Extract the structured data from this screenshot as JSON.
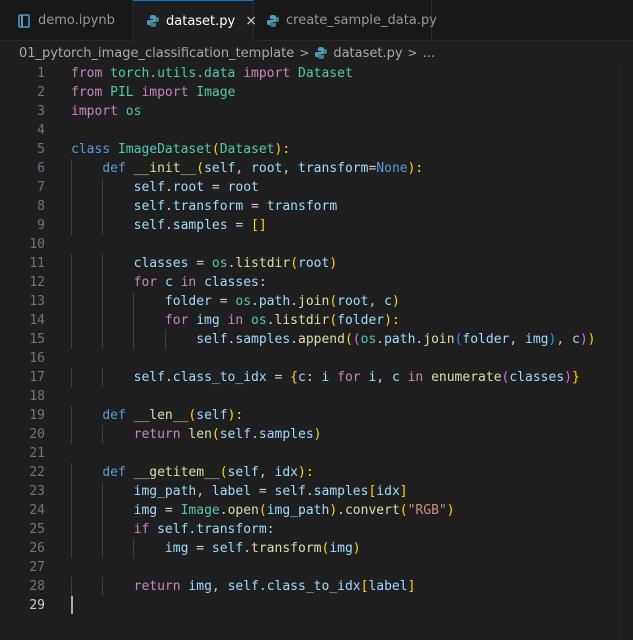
{
  "tabs": [
    {
      "label": "demo.ipynb",
      "icon": "notebook-icon",
      "active": false
    },
    {
      "label": "dataset.py",
      "icon": "python-icon",
      "active": true,
      "close": "×"
    },
    {
      "label": "create_sample_data.py",
      "icon": "python-icon",
      "active": false
    }
  ],
  "breadcrumb": {
    "folder": "01_pytorch_image_classification_template",
    "sep": ">",
    "file": "dataset.py",
    "more": "..."
  },
  "editor": {
    "current_line": 29,
    "lines": [
      [
        [
          "from ",
          "k"
        ],
        [
          "torch.utils.data",
          "c"
        ],
        [
          " ",
          ""
        ],
        [
          "import",
          "k"
        ],
        [
          " Dataset",
          "c"
        ]
      ],
      [
        [
          "from ",
          "k"
        ],
        [
          "PIL",
          "c"
        ],
        [
          " ",
          ""
        ],
        [
          "import",
          "k"
        ],
        [
          " Image",
          "c"
        ]
      ],
      [
        [
          "import",
          "k"
        ],
        [
          " os",
          "c"
        ]
      ],
      [],
      [
        [
          "class ",
          "b"
        ],
        [
          "ImageDataset",
          "c"
        ],
        [
          "(",
          "p1"
        ],
        [
          "Dataset",
          "c"
        ],
        [
          "):",
          "p1"
        ]
      ],
      [
        [
          "    ",
          ""
        ],
        [
          "def ",
          "b"
        ],
        [
          "__init__",
          "f"
        ],
        [
          "(",
          "p1"
        ],
        [
          "self",
          "v"
        ],
        [
          ", ",
          ""
        ],
        [
          "root",
          "v"
        ],
        [
          ", ",
          ""
        ],
        [
          "transform",
          "v"
        ],
        [
          "=",
          ""
        ],
        [
          "None",
          "b"
        ],
        [
          "):",
          "p1"
        ]
      ],
      [
        [
          "        ",
          ""
        ],
        [
          "self",
          "v"
        ],
        [
          ".",
          ""
        ],
        [
          "root",
          "v"
        ],
        [
          " = ",
          ""
        ],
        [
          "root",
          "v"
        ]
      ],
      [
        [
          "        ",
          ""
        ],
        [
          "self",
          "v"
        ],
        [
          ".",
          ""
        ],
        [
          "transform",
          "v"
        ],
        [
          " = ",
          ""
        ],
        [
          "transform",
          "v"
        ]
      ],
      [
        [
          "        ",
          ""
        ],
        [
          "self",
          "v"
        ],
        [
          ".",
          ""
        ],
        [
          "samples",
          "v"
        ],
        [
          " = ",
          ""
        ],
        [
          "[]",
          "p1"
        ]
      ],
      [],
      [
        [
          "        ",
          ""
        ],
        [
          "classes",
          "v"
        ],
        [
          " = ",
          ""
        ],
        [
          "os",
          "c"
        ],
        [
          ".",
          ""
        ],
        [
          "listdir",
          "f"
        ],
        [
          "(",
          "p1"
        ],
        [
          "root",
          "v"
        ],
        [
          ")",
          "p1"
        ]
      ],
      [
        [
          "        ",
          ""
        ],
        [
          "for ",
          "k"
        ],
        [
          "c",
          "v"
        ],
        [
          " in ",
          "k"
        ],
        [
          "classes",
          "v"
        ],
        [
          ":",
          ""
        ]
      ],
      [
        [
          "            ",
          ""
        ],
        [
          "folder",
          "v"
        ],
        [
          " = ",
          ""
        ],
        [
          "os",
          "c"
        ],
        [
          ".",
          ""
        ],
        [
          "path",
          "v"
        ],
        [
          ".",
          ""
        ],
        [
          "join",
          "f"
        ],
        [
          "(",
          "p1"
        ],
        [
          "root",
          "v"
        ],
        [
          ", ",
          ""
        ],
        [
          "c",
          "v"
        ],
        [
          ")",
          "p1"
        ]
      ],
      [
        [
          "            ",
          ""
        ],
        [
          "for ",
          "k"
        ],
        [
          "img",
          "v"
        ],
        [
          " in ",
          "k"
        ],
        [
          "os",
          "c"
        ],
        [
          ".",
          ""
        ],
        [
          "listdir",
          "f"
        ],
        [
          "(",
          "p1"
        ],
        [
          "folder",
          "v"
        ],
        [
          "):",
          "p1"
        ]
      ],
      [
        [
          "                ",
          ""
        ],
        [
          "self",
          "v"
        ],
        [
          ".",
          ""
        ],
        [
          "samples",
          "v"
        ],
        [
          ".",
          ""
        ],
        [
          "append",
          "f"
        ],
        [
          "(",
          "p1"
        ],
        [
          "(",
          "p2"
        ],
        [
          "os",
          "c"
        ],
        [
          ".",
          ""
        ],
        [
          "path",
          "v"
        ],
        [
          ".",
          ""
        ],
        [
          "join",
          "f"
        ],
        [
          "(",
          "p3"
        ],
        [
          "folder",
          "v"
        ],
        [
          ", ",
          ""
        ],
        [
          "img",
          "v"
        ],
        [
          ")",
          "p3"
        ],
        [
          ", ",
          ""
        ],
        [
          "c",
          "v"
        ],
        [
          ")",
          "p2"
        ],
        [
          ")",
          "p1"
        ]
      ],
      [],
      [
        [
          "        ",
          ""
        ],
        [
          "self",
          "v"
        ],
        [
          ".",
          ""
        ],
        [
          "class_to_idx",
          "v"
        ],
        [
          " = ",
          ""
        ],
        [
          "{",
          "p1"
        ],
        [
          "c",
          "v"
        ],
        [
          ": ",
          ""
        ],
        [
          "i",
          "v"
        ],
        [
          " for ",
          "k"
        ],
        [
          "i",
          "v"
        ],
        [
          ", ",
          ""
        ],
        [
          "c",
          "v"
        ],
        [
          " in ",
          "k"
        ],
        [
          "enumerate",
          "f"
        ],
        [
          "(",
          "p2"
        ],
        [
          "classes",
          "v"
        ],
        [
          ")",
          "p2"
        ],
        [
          "}",
          "p1"
        ]
      ],
      [],
      [
        [
          "    ",
          ""
        ],
        [
          "def ",
          "b"
        ],
        [
          "__len__",
          "f"
        ],
        [
          "(",
          "p1"
        ],
        [
          "self",
          "v"
        ],
        [
          "):",
          "p1"
        ]
      ],
      [
        [
          "        ",
          ""
        ],
        [
          "return ",
          "k"
        ],
        [
          "len",
          "f"
        ],
        [
          "(",
          "p1"
        ],
        [
          "self",
          "v"
        ],
        [
          ".",
          ""
        ],
        [
          "samples",
          "v"
        ],
        [
          ")",
          "p1"
        ]
      ],
      [],
      [
        [
          "    ",
          ""
        ],
        [
          "def ",
          "b"
        ],
        [
          "__getitem__",
          "f"
        ],
        [
          "(",
          "p1"
        ],
        [
          "self",
          "v"
        ],
        [
          ", ",
          ""
        ],
        [
          "idx",
          "v"
        ],
        [
          "):",
          "p1"
        ]
      ],
      [
        [
          "        ",
          ""
        ],
        [
          "img_path",
          "v"
        ],
        [
          ", ",
          ""
        ],
        [
          "label",
          "v"
        ],
        [
          " = ",
          ""
        ],
        [
          "self",
          "v"
        ],
        [
          ".",
          ""
        ],
        [
          "samples",
          "v"
        ],
        [
          "[",
          "p1"
        ],
        [
          "idx",
          "v"
        ],
        [
          "]",
          "p1"
        ]
      ],
      [
        [
          "        ",
          ""
        ],
        [
          "img",
          "v"
        ],
        [
          " = ",
          ""
        ],
        [
          "Image",
          "c"
        ],
        [
          ".",
          ""
        ],
        [
          "open",
          "f"
        ],
        [
          "(",
          "p1"
        ],
        [
          "img_path",
          "v"
        ],
        [
          ")",
          "p1"
        ],
        [
          ".",
          ""
        ],
        [
          "convert",
          "f"
        ],
        [
          "(",
          "p1"
        ],
        [
          "\"RGB\"",
          "s"
        ],
        [
          ")",
          "p1"
        ]
      ],
      [
        [
          "        ",
          ""
        ],
        [
          "if ",
          "k"
        ],
        [
          "self",
          "v"
        ],
        [
          ".",
          ""
        ],
        [
          "transform",
          "v"
        ],
        [
          ":",
          ""
        ]
      ],
      [
        [
          "            ",
          ""
        ],
        [
          "img",
          "v"
        ],
        [
          " = ",
          ""
        ],
        [
          "self",
          "v"
        ],
        [
          ".",
          ""
        ],
        [
          "transform",
          "f"
        ],
        [
          "(",
          "p1"
        ],
        [
          "img",
          "v"
        ],
        [
          ")",
          "p1"
        ]
      ],
      [],
      [
        [
          "        ",
          ""
        ],
        [
          "return ",
          "k"
        ],
        [
          "img",
          "v"
        ],
        [
          ", ",
          ""
        ],
        [
          "self",
          "v"
        ],
        [
          ".",
          ""
        ],
        [
          "class_to_idx",
          "v"
        ],
        [
          "[",
          "p1"
        ],
        [
          "label",
          "v"
        ],
        [
          "]",
          "p1"
        ]
      ],
      []
    ]
  }
}
